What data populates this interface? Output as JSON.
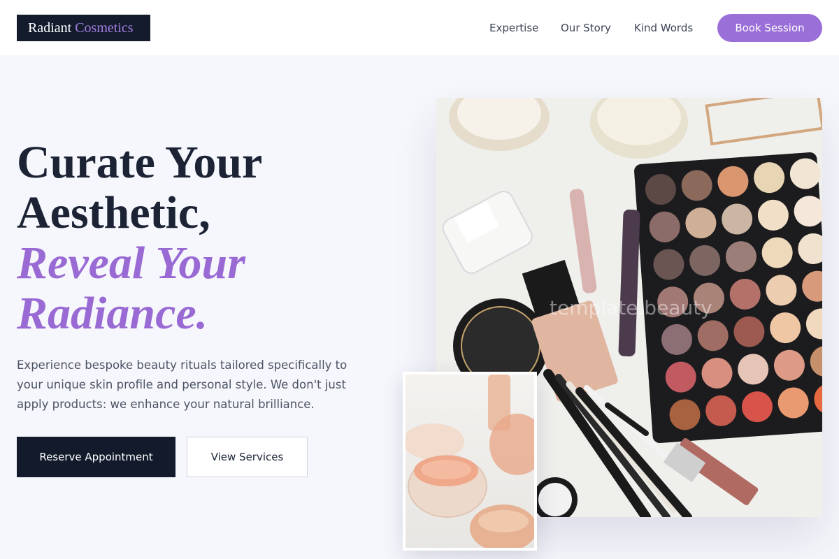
{
  "brand": {
    "word1": "Radiant",
    "word2": "Cosmetics"
  },
  "nav": {
    "links": [
      "Expertise",
      "Our Story",
      "Kind Words"
    ],
    "cta": "Book Session"
  },
  "hero": {
    "title_line1": "Curate Your",
    "title_line2": "Aesthetic,",
    "title_accent1": "Reveal Your",
    "title_accent2": "Radiance.",
    "description": "Experience bespoke beauty rituals tailored specifically to your unique skin profile and personal style. We don't just apply products: we enhance your natural brilliance.",
    "primary_button": "Reserve Appointment",
    "secondary_button": "View Services"
  },
  "images": {
    "main_watermark": "template.beauty",
    "main_alt": "makeup flat lay with eyeshadow palette, brushes and cosmetics",
    "small_alt": "close-up of loose powder jars"
  },
  "colors": {
    "brand_dark": "#141b2d",
    "accent_purple": "#9b6fd8",
    "page_bg": "#f6f7fc"
  }
}
